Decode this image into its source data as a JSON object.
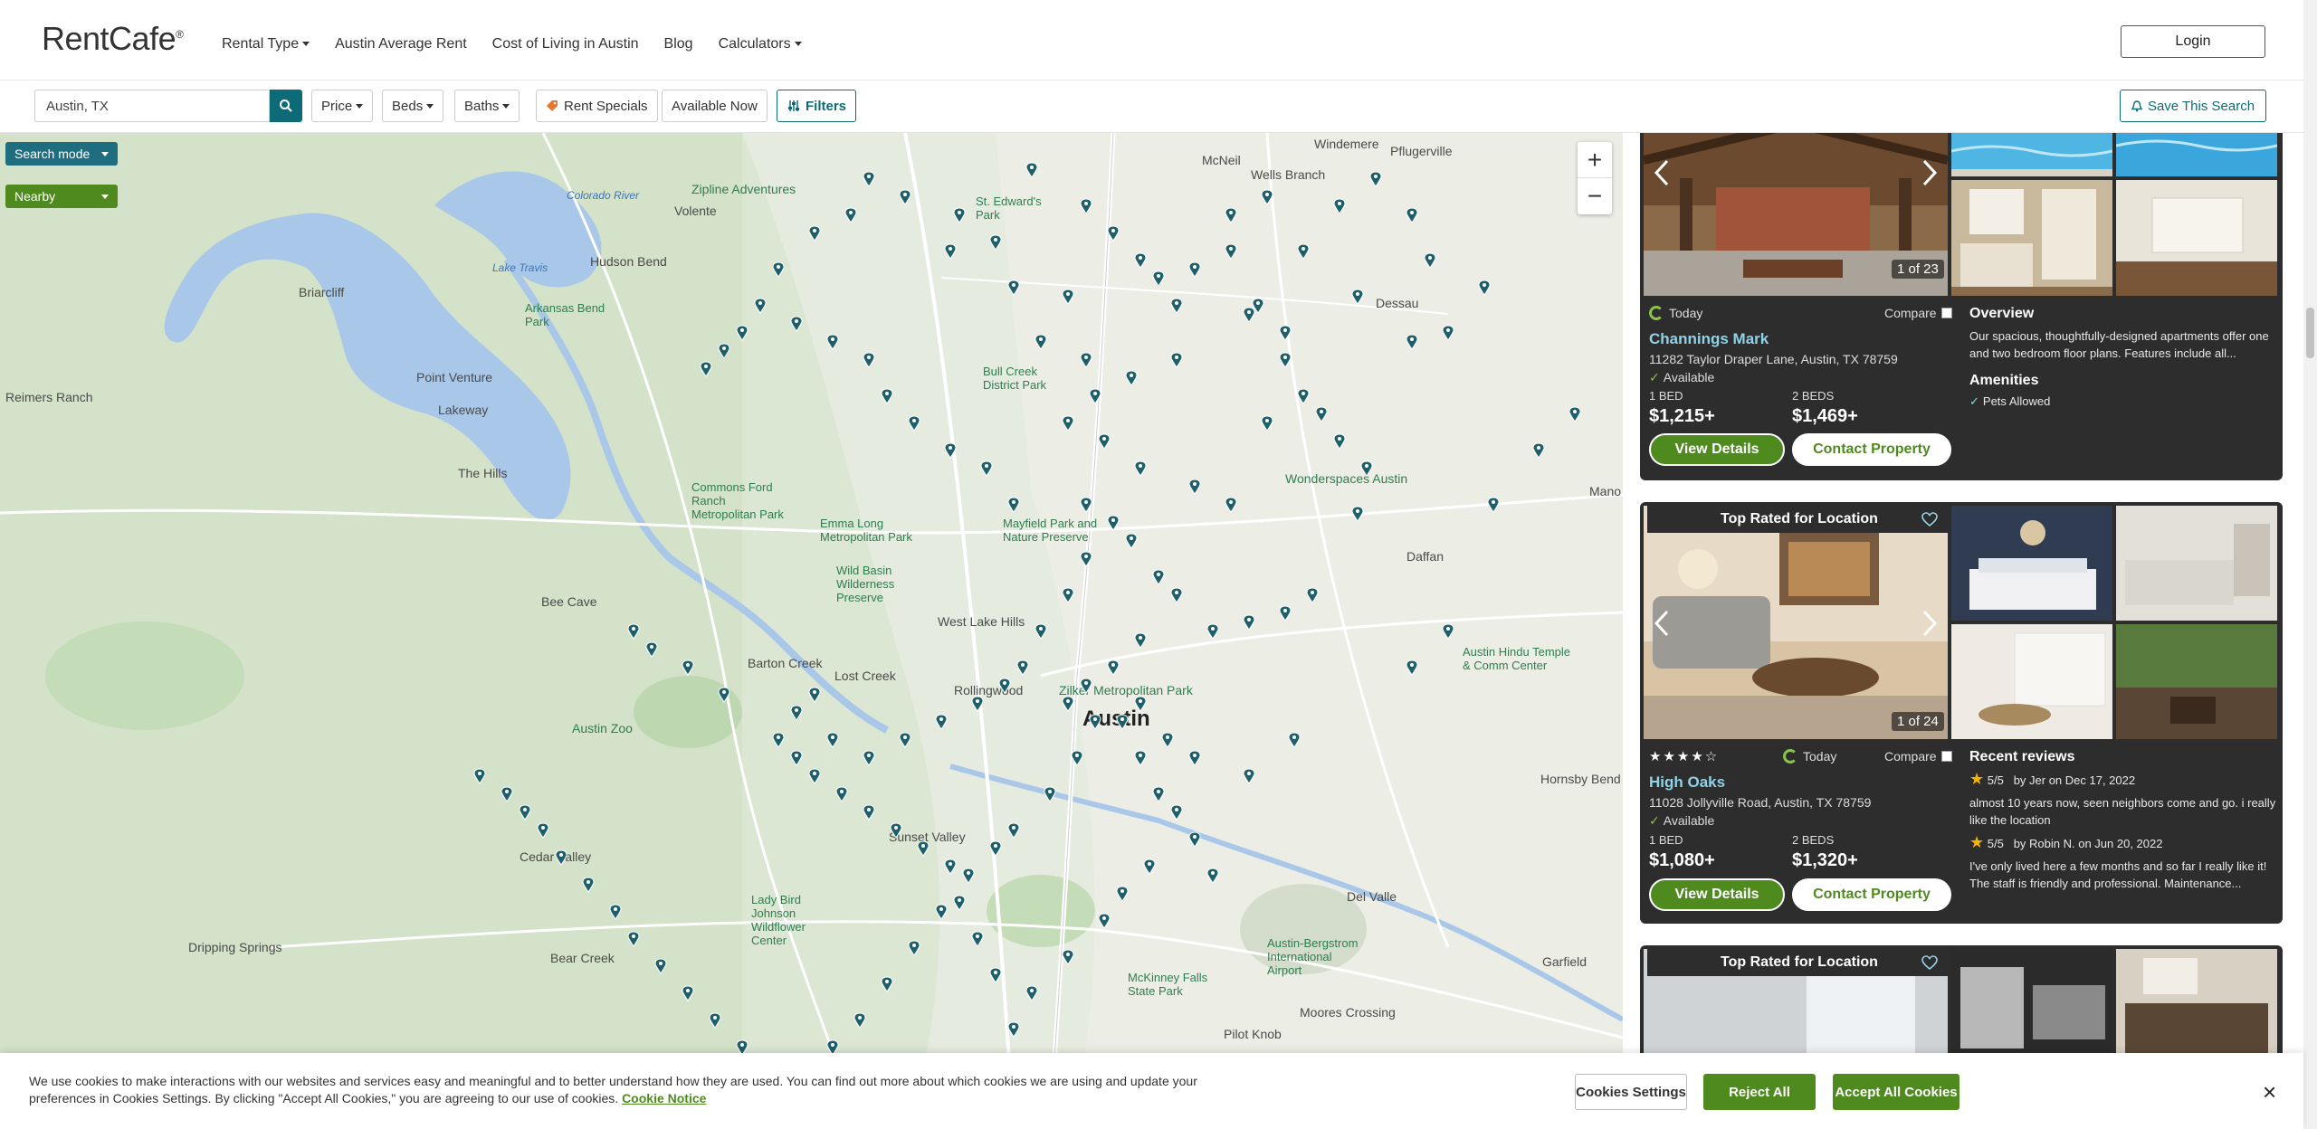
{
  "header": {
    "logo": "RentCafe",
    "logo_mark": "®",
    "nav": [
      {
        "label": "Rental Type",
        "dropdown": true
      },
      {
        "label": "Austin Average Rent",
        "dropdown": false
      },
      {
        "label": "Cost of Living in Austin",
        "dropdown": false
      },
      {
        "label": "Blog",
        "dropdown": false
      },
      {
        "label": "Calculators",
        "dropdown": true
      }
    ],
    "login_label": "Login"
  },
  "filters": {
    "search_value": "Austin, TX",
    "price_label": "Price",
    "beds_label": "Beds",
    "baths_label": "Baths",
    "rent_specials_label": "Rent Specials",
    "available_now_label": "Available Now",
    "filters_label": "Filters",
    "save_search_label": "Save This Search"
  },
  "map": {
    "search_mode_label": "Search mode",
    "nearby_label": "Nearby",
    "zoom_in": "+",
    "zoom_out": "−",
    "labels": {
      "austin": "Austin",
      "volente": "Volente",
      "hudson_bend": "Hudson Bend",
      "briarcliff": "Briarcliff",
      "lakeway": "Lakeway",
      "point_venture": "Point Venture",
      "the_hills": "The Hills",
      "bee_cave": "Bee Cave",
      "west_lake_hills": "West Lake Hills",
      "lost_creek": "Lost Creek",
      "barton_creek": "Barton Creek",
      "rollingwood": "Rollingwood",
      "cedar_valley": "Cedar Valley",
      "sunset_valley": "Sunset Valley",
      "bear_creek": "Bear Creek",
      "dripping_springs": "Dripping Springs",
      "pflugerville": "Pflugerville",
      "wells_branch": "Wells Branch",
      "mcneil": "McNeil",
      "daffan": "Daffan",
      "del_valle": "Del Valle",
      "garfield": "Garfield",
      "hornsby_bend": "Hornsby Bend",
      "pilot_knob": "Pilot Knob",
      "moores_crossing": "Moores Crossing",
      "windemere": "Windemere",
      "dessau": "Dessau",
      "reimers_ranch": "Reimers Ranch",
      "manor": "Mano",
      "zilker": "Zilker Metropolitan Park",
      "austin_zoo": "Austin Zoo",
      "zipline": "Zipline Adventures",
      "wonderspaces": "Wonderspaces Austin",
      "airport": "Austin-Bergstrom International Airport",
      "hindu_temple": "Austin Hindu Temple & Comm Center",
      "mckinney": "McKinney Falls State Park",
      "wildflower": "Lady Bird Johnson Wildflower Center",
      "commons_ford": "Commons Ford Ranch Metropolitan Park",
      "emma_long": "Emma Long Metropolitan Park",
      "wild_basin": "Wild Basin Wilderness Preserve",
      "mayfield": "Mayfield Park and Nature Preserve",
      "st_edwards": "St. Edward's Park",
      "bull_creek": "Bull Creek District Park",
      "arkansas_bend": "Arkansas Bend Park",
      "lake_travis": "Lake Travis",
      "colorado_river": "Colorado River"
    }
  },
  "listings": [
    {
      "tag": "",
      "photo_counter": "1 of 23",
      "today_label": "Today",
      "compare_label": "Compare",
      "name": "Channings Mark",
      "address": "11282 Taylor Draper Lane, Austin, TX 78759",
      "available": "Available",
      "beds": [
        {
          "label": "1 BED",
          "price": "$1,215+"
        },
        {
          "label": "2 BEDS",
          "price": "$1,469+"
        }
      ],
      "view_label": "View Details",
      "contact_label": "Contact Property",
      "overview_title": "Overview",
      "overview_text": "Our spacious, thoughtfully-designed apartments offer one and two bedroom floor plans. Features include all...",
      "amenities_title": "Amenities",
      "amenity": "Pets Allowed"
    },
    {
      "tag": "Top Rated for Location",
      "photo_counter": "1 of 24",
      "today_label": "Today",
      "compare_label": "Compare",
      "rating": 4,
      "name": "High Oaks",
      "address": "11028 Jollyville Road, Austin, TX 78759",
      "available": "Available",
      "beds": [
        {
          "label": "1 BED",
          "price": "$1,080+"
        },
        {
          "label": "2 BEDS",
          "price": "$1,320+"
        }
      ],
      "view_label": "View Details",
      "contact_label": "Contact Property",
      "reviews_title": "Recent reviews",
      "reviews": [
        {
          "score": "5/5",
          "by": "by Jer on Dec 17, 2022",
          "text": "almost 10 years now, seen neighbors come and go. i really like the location"
        },
        {
          "score": "5/5",
          "by": "by Robin N. on Jun 20, 2022",
          "text": "I've only lived here a few months and so far I really like it! The staff is friendly and professional. Maintenance..."
        }
      ]
    },
    {
      "tag": "Top Rated for Location"
    }
  ],
  "cookie": {
    "text": "We use cookies to make interactions with our websites and services easy and meaningful and to better understand how they are used. You can find out more about which cookies we are using and update your preferences in Cookies Settings. By clicking \"Accept All Cookies,\" you are agreeing to our use of cookies.",
    "link": "Cookie Notice",
    "settings_label": "Cookies Settings",
    "reject_label": "Reject All",
    "accept_label": "Accept All Cookies",
    "close": "×"
  },
  "colors": {
    "brand_teal": "#0d6b78",
    "brand_green": "#4f8a1f",
    "card_bg": "#2d2d2d",
    "pin": "#1d5f6b"
  }
}
